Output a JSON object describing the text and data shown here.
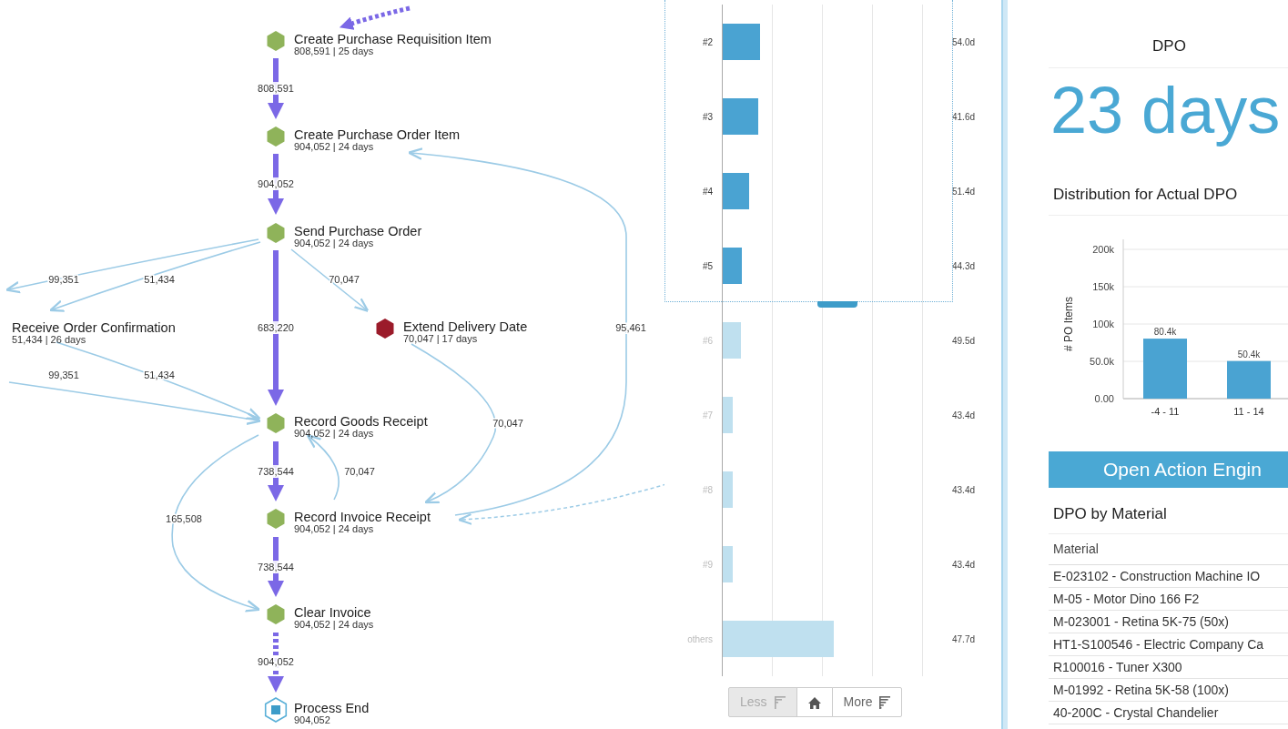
{
  "process_map": {
    "nodes": [
      {
        "name": "Create Purchase Requisition Item",
        "stats": "808,591 | 25 days",
        "kind": "activity"
      },
      {
        "name": "Create Purchase Order Item",
        "stats": "904,052 | 24 days",
        "kind": "activity"
      },
      {
        "name": "Send Purchase Order",
        "stats": "904,052 | 24 days",
        "kind": "activity"
      },
      {
        "name": "Receive Order Confirmation",
        "stats": "51,434 | 26 days",
        "kind": "offscreen"
      },
      {
        "name": "Extend Delivery Date",
        "stats": "70,047 | 17 days",
        "kind": "deviation"
      },
      {
        "name": "Record Goods Receipt",
        "stats": "904,052 | 24 days",
        "kind": "activity"
      },
      {
        "name": "Record Invoice Receipt",
        "stats": "904,052 | 24 days",
        "kind": "activity"
      },
      {
        "name": "Clear Invoice",
        "stats": "904,052 | 24 days",
        "kind": "activity"
      },
      {
        "name": "Process End",
        "stats": "904,052",
        "kind": "end"
      }
    ],
    "edges": [
      {
        "label": "808,591",
        "kind": "main"
      },
      {
        "label": "904,052",
        "kind": "main"
      },
      {
        "label": "99,351",
        "kind": "side"
      },
      {
        "label": "51,434",
        "kind": "side"
      },
      {
        "label": "70,047",
        "kind": "side"
      },
      {
        "label": "683,220",
        "kind": "main"
      },
      {
        "label": "95,461",
        "kind": "side"
      },
      {
        "label": "99,351",
        "kind": "side"
      },
      {
        "label": "51,434",
        "kind": "side"
      },
      {
        "label": "70,047",
        "kind": "side"
      },
      {
        "label": "738,544",
        "kind": "main"
      },
      {
        "label": "70,047",
        "kind": "side"
      },
      {
        "label": "165,508",
        "kind": "side"
      },
      {
        "label": "738,544",
        "kind": "main"
      },
      {
        "label": "904,052",
        "kind": "main-dashed"
      }
    ]
  },
  "ranking": {
    "rows": [
      {
        "label": "#2",
        "value": "54.0d",
        "level": 0.164,
        "selected": true
      },
      {
        "label": "#3",
        "value": "41.6d",
        "level": 0.156,
        "selected": true
      },
      {
        "label": "#4",
        "value": "51.4d",
        "level": 0.116,
        "selected": true
      },
      {
        "label": "#5",
        "value": "44.3d",
        "level": 0.084,
        "selected": true
      },
      {
        "label": "#6",
        "value": "49.5d",
        "level": 0.08,
        "selected": false
      },
      {
        "label": "#7",
        "value": "43.4d",
        "level": 0.044,
        "selected": false
      },
      {
        "label": "#8",
        "value": "43.4d",
        "level": 0.044,
        "selected": false
      },
      {
        "label": "#9",
        "value": "43.4d",
        "level": 0.044,
        "selected": false
      },
      {
        "label": "others",
        "value": "47.7d",
        "level": 0.488,
        "selected": false
      }
    ],
    "buttons": [
      {
        "label": "Less",
        "kind": "less",
        "disabled": true
      },
      {
        "kind": "home",
        "disabled": false
      },
      {
        "label": "More",
        "kind": "more",
        "disabled": false
      }
    ]
  },
  "kpi": {
    "title": "DPO",
    "value": "23 days"
  },
  "distribution": {
    "title": "Distribution for Actual DPO",
    "chart_data": {
      "type": "bar",
      "grid": true,
      "ylabel": "# PO Items",
      "categories": [
        "-4 - 11",
        "11 - 14"
      ],
      "values": [
        80400,
        50400
      ],
      "value_labels": [
        "80.4k",
        "50.4k"
      ],
      "ylim": [
        0,
        200000
      ],
      "yticks": [
        {
          "value": 0,
          "label": "0.00"
        },
        {
          "value": 50000,
          "label": "50.0k"
        },
        {
          "value": 100000,
          "label": "100k"
        },
        {
          "value": 150000,
          "label": "150k"
        },
        {
          "value": 200000,
          "label": "200k"
        }
      ]
    }
  },
  "action_button": {
    "label": "Open Action Engin"
  },
  "material_table": {
    "title": "DPO by Material",
    "columns": [
      "Material"
    ],
    "rows": [
      [
        "E-023102 - Construction Machine IO"
      ],
      [
        "M-05 - Motor Dino 166 F2"
      ],
      [
        "M-023001 - Retina 5K-75 (50x)"
      ],
      [
        "HT1-S100546 - Electric Company Ca"
      ],
      [
        "R100016 - Tuner X300"
      ],
      [
        "M-01992 - Retina 5K-58 (100x)"
      ],
      [
        "40-200C - Crystal Chandelier"
      ]
    ]
  }
}
